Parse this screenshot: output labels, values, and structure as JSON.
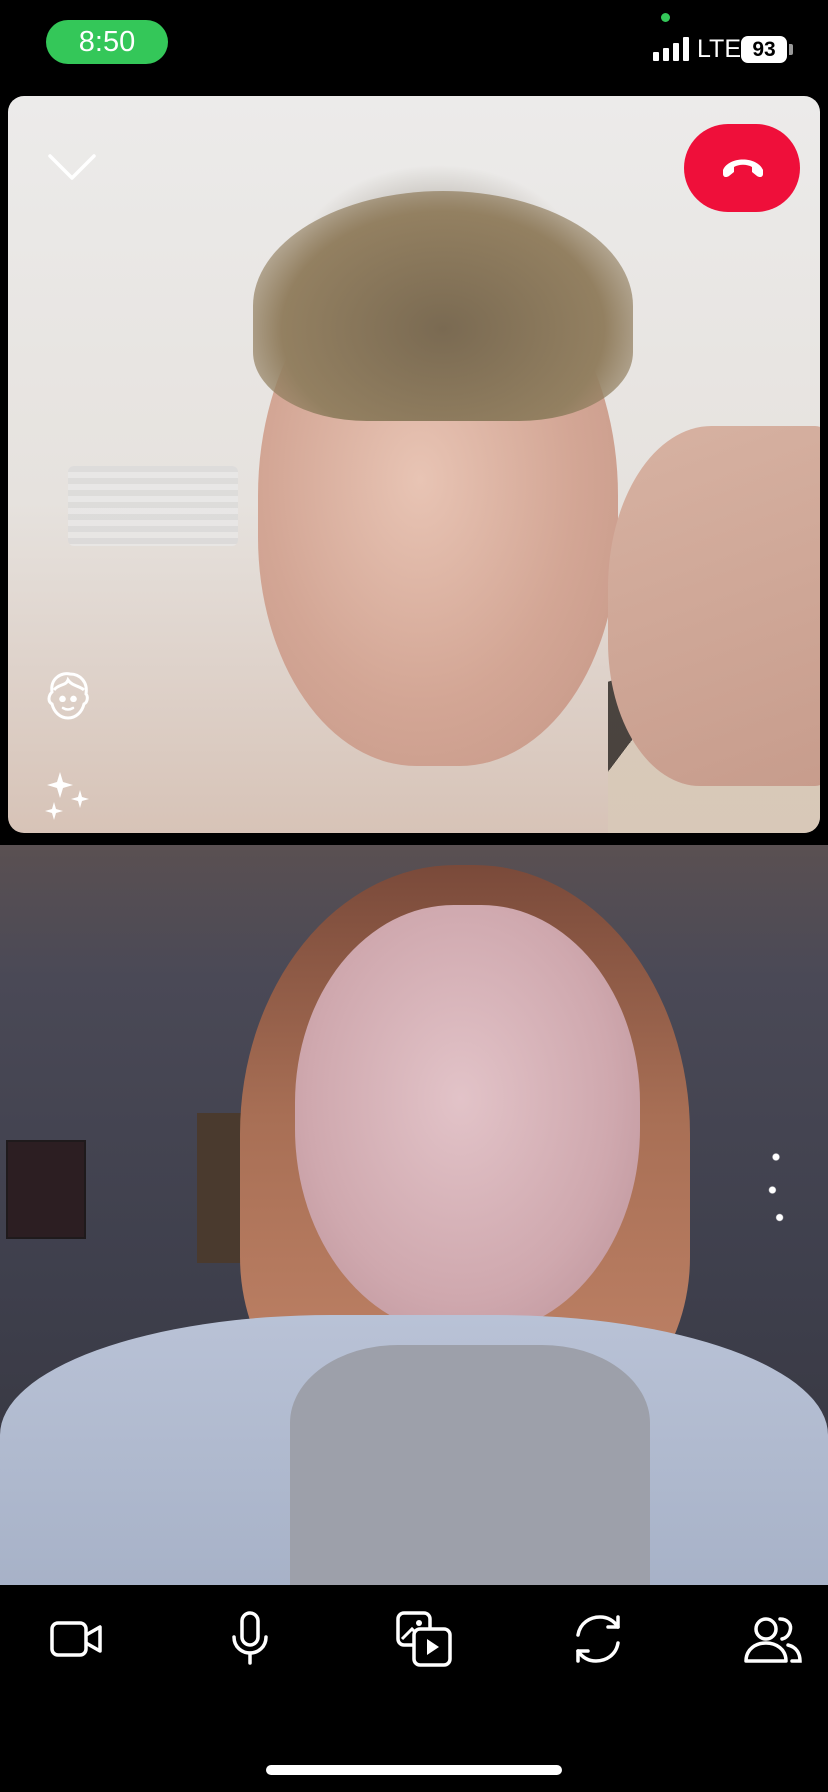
{
  "status_bar": {
    "time": "8:50",
    "network": "LTE",
    "battery_level": "93",
    "icons": [
      "signal-icon",
      "battery-icon",
      "mic-indicator-icon"
    ]
  },
  "call": {
    "top_video": {
      "icons": [
        "chevron-down-icon",
        "end-call-icon",
        "face-lens-icon",
        "sparkles-icon"
      ]
    },
    "bottom_video": {},
    "toolbar": {
      "icons": [
        "video-camera-icon",
        "microphone-icon",
        "media-share-icon",
        "flip-camera-icon",
        "participants-icon"
      ]
    }
  },
  "colors": {
    "time_pill": "#34c759",
    "end_call": "#ef0f3a",
    "background": "#000000"
  }
}
